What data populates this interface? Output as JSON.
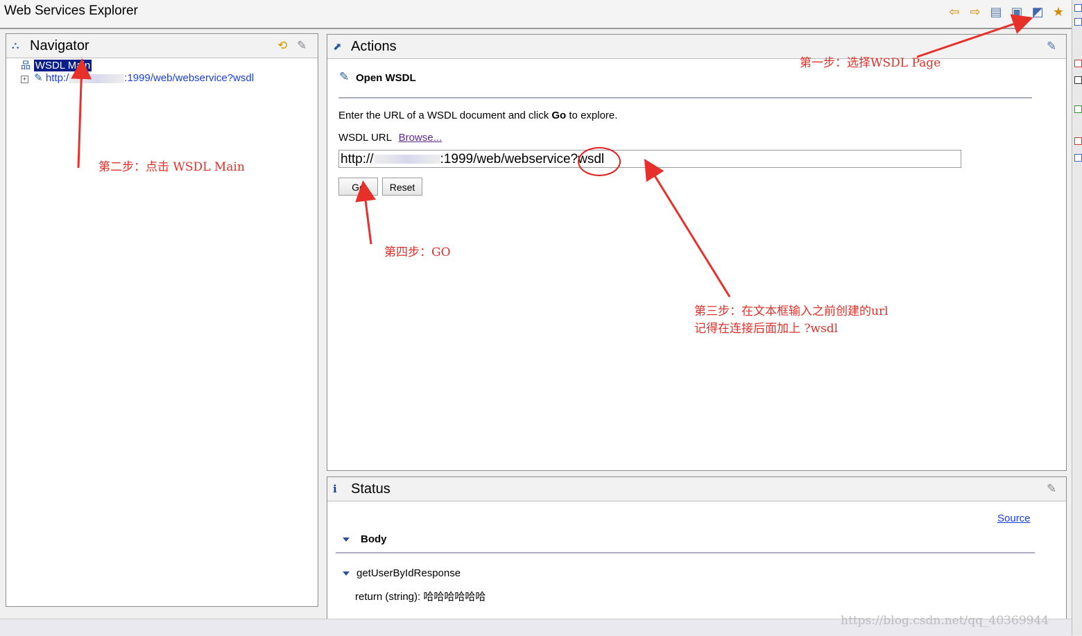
{
  "window": {
    "title": "Web Services Explorer"
  },
  "toolbar": {
    "icons": [
      "back-arrow-icon",
      "forward-arrow-icon",
      "uddi-page-icon",
      "wsil-page-icon",
      "wsdl-page-icon",
      "favorites-star-icon"
    ]
  },
  "navigator": {
    "title": "Navigator",
    "root_label": "WSDL Main",
    "child_prefix": "http:/",
    "child_suffix": ":1999/web/webservice?wsdl"
  },
  "actions": {
    "title": "Actions",
    "section_title": "Open WSDL",
    "description_pre": "Enter the URL of a WSDL document and click ",
    "description_go": "Go",
    "description_post": " to explore.",
    "url_label": "WSDL URL",
    "browse_link": "Browse...",
    "url_prefix": "http://",
    "url_suffix": ":1999/web/webservice?wsdl",
    "go_button": "Go",
    "reset_button": "Reset"
  },
  "status": {
    "title": "Status",
    "source_link": "Source",
    "body_label": "Body",
    "response_label": "getUserByIdResponse",
    "return_label": "return (string):",
    "return_value": "哈哈哈哈哈哈"
  },
  "annotations": {
    "step1": "第一步：选择WSDL Page",
    "step2": "第二步：点击 WSDL Main",
    "step3_line1": "第三步：在文本框输入之前创建的url",
    "step3_line2": "记得在连接后面加上  ?wsdl",
    "step4": "第四步：GO",
    "color": "#e0302a"
  },
  "watermark": "https://blog.csdn.net/qq_40369944"
}
